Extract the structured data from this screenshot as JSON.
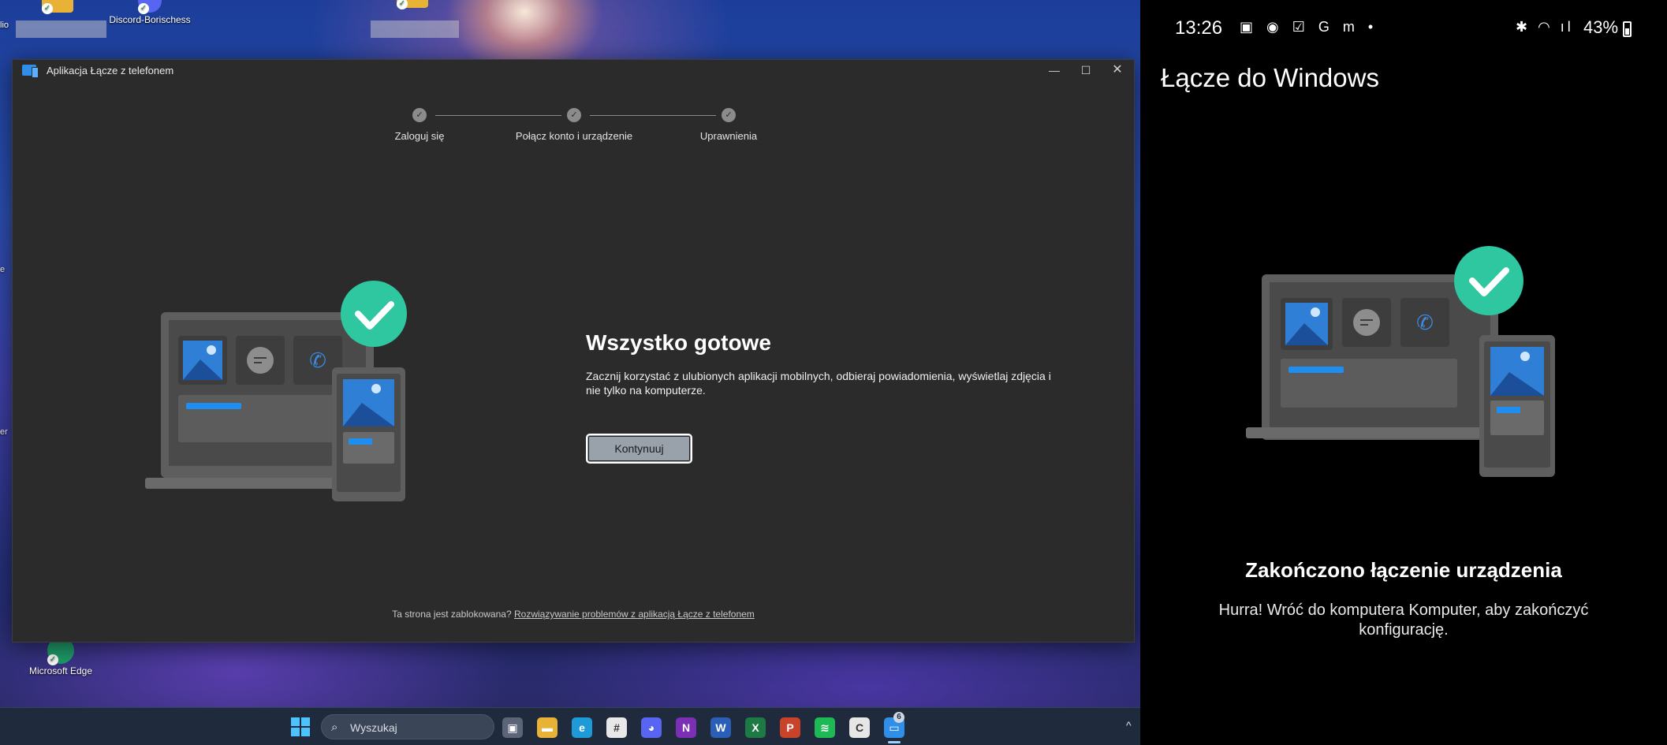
{
  "desktop": {
    "icons": [
      {
        "label": "Discord-Borischess"
      },
      {
        "label": "Microsoft Edge"
      }
    ],
    "edge_fragments": [
      "lio",
      "e",
      "er"
    ]
  },
  "window": {
    "title": "Aplikacja Łącze z telefonem",
    "controls": {
      "minimize": "—",
      "maximize": "☐",
      "close": "✕"
    },
    "steps": [
      {
        "label": "Zaloguj się",
        "state": "done"
      },
      {
        "label": "Połącz konto i urządzenie",
        "state": "done"
      },
      {
        "label": "Uprawnienia",
        "state": "done"
      }
    ],
    "heading": "Wszystko gotowe",
    "description": "Zacznij korzystać z ulubionych aplikacji mobilnych, odbieraj powiadomienia, wyświetlaj zdjęcia i nie tylko na komputerze.",
    "continue_label": "Kontynuuj",
    "footer_text": "Ta strona jest zablokowana?",
    "footer_link": "Rozwiązywanie problemów z aplikacją Łącze z telefonem"
  },
  "taskbar": {
    "search_placeholder": "Wyszukaj",
    "pinned": [
      {
        "name": "task-view-icon",
        "glyph": "▣",
        "color": "#5b6478"
      },
      {
        "name": "file-explorer-icon",
        "glyph": "▬",
        "color": "#e8b236"
      },
      {
        "name": "edge-icon",
        "glyph": "e",
        "color": "#1f9ad8"
      },
      {
        "name": "slack-icon",
        "glyph": "#",
        "color": "#e8e8e8"
      },
      {
        "name": "discord-icon",
        "glyph": "◕",
        "color": "#5865f2"
      },
      {
        "name": "onenote-icon",
        "glyph": "N",
        "color": "#7b2fb4"
      },
      {
        "name": "word-icon",
        "glyph": "W",
        "color": "#2b5eb6"
      },
      {
        "name": "excel-icon",
        "glyph": "X",
        "color": "#1d7a45"
      },
      {
        "name": "powerpoint-icon",
        "glyph": "P",
        "color": "#c9432a"
      },
      {
        "name": "spotify-icon",
        "glyph": "≋",
        "color": "#1db954"
      },
      {
        "name": "generic-app-icon",
        "glyph": "C",
        "color": "#e6e6e6"
      },
      {
        "name": "phone-link-icon",
        "glyph": "▭",
        "color": "#2f8fe8"
      }
    ],
    "phone_link_badge": "6",
    "tray_chevron": "^"
  },
  "phone": {
    "time": "13:26",
    "status_icons": "▣ ◉ ☑ G m •",
    "right_icons": "✱ ◠ ıl",
    "battery": "43%",
    "title": "Łącze do Windows",
    "heading": "Zakończono łączenie urządzenia",
    "description": "Hurra! Wróć do komputera Komputer, aby zakończyć konfigurację."
  },
  "colors": {
    "window_bg": "#2b2b2b",
    "button_bg": "#99a1ab",
    "check_green": "#2fc7a0",
    "accent_blue": "#2f8fe8"
  }
}
